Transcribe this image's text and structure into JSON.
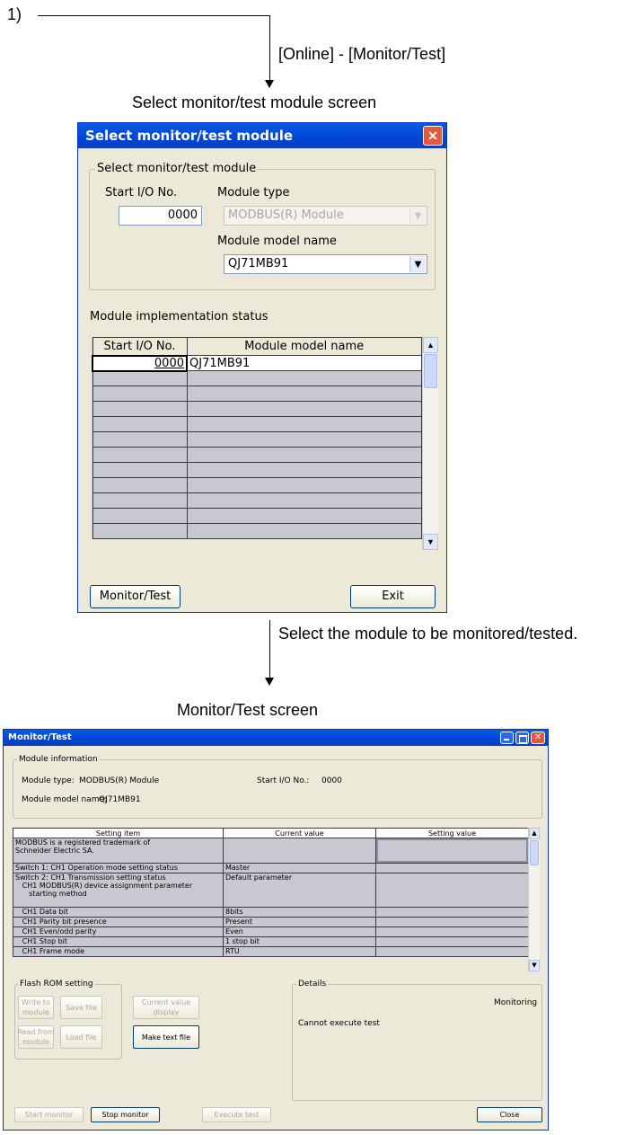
{
  "flow": {
    "step_label": "1)",
    "menu_path": "[Online] - [Monitor/Test]",
    "screen1_caption": "Select monitor/test module screen",
    "step2_text": "Select the module to be monitored/tested.",
    "screen2_caption": "Monitor/Test screen"
  },
  "select_dialog": {
    "title": "Select monitor/test module",
    "group_label": "Select monitor/test module",
    "start_io_label": "Start I/O No.",
    "start_io_value": "0000",
    "module_type_label": "Module type",
    "module_type_value": "MODBUS(R) Module",
    "model_name_label": "Module model name",
    "model_name_value": "QJ71MB91",
    "status_label": "Module implementation status",
    "columns": [
      "Start I/O No.",
      "Module model name"
    ],
    "rows": [
      {
        "io": "0000",
        "model": "QJ71MB91"
      }
    ],
    "monitor_button": "Monitor/Test",
    "exit_button": "Exit"
  },
  "monitor_window": {
    "title": "Monitor/Test",
    "info_group": "Module information",
    "module_type_label": "Module type:",
    "module_type_value": "MODBUS(R) Module",
    "start_io_label": "Start I/O No.:",
    "start_io_value": "0000",
    "model_name_label": "Module model name:",
    "model_name_value": "QJ71MB91",
    "columns": [
      "Setting item",
      "Current value",
      "Setting value"
    ],
    "rows": [
      {
        "item": "MODBUS is a registered trademark of\nSchneider Electric SA.",
        "current": "",
        "setting": ""
      },
      {
        "item": "Switch 1: CH1 Operation mode setting status",
        "current": "Master",
        "setting": ""
      },
      {
        "item": "Switch 2: CH1 Transmission setting status\n   CH1 MODBUS(R) device assignment parameter\n      starting method",
        "current": "Default parameter",
        "setting": ""
      },
      {
        "item": "   CH1 Data bit",
        "current": "8bits",
        "setting": ""
      },
      {
        "item": "   CH1 Parity bit presence",
        "current": "Present",
        "setting": ""
      },
      {
        "item": "   CH1 Even/odd parity",
        "current": "Even",
        "setting": ""
      },
      {
        "item": "   CH1 Stop bit",
        "current": "1 stop bit",
        "setting": ""
      },
      {
        "item": "   CH1 Frame mode",
        "current": "RTU",
        "setting": ""
      }
    ],
    "flash_group": "Flash ROM setting",
    "write_to_module": "Write to\nmodule",
    "save_file": "Save file",
    "read_from_module": "Read from\nmodule",
    "load_file": "Load file",
    "current_value_display": "Current value\ndisplay",
    "make_text_file": "Make text file",
    "details_group": "Details",
    "details_status": "Monitoring",
    "details_message": "Cannot execute test",
    "start_monitor": "Start monitor",
    "stop_monitor": "Stop monitor",
    "execute_test": "Execute test",
    "close": "Close"
  }
}
